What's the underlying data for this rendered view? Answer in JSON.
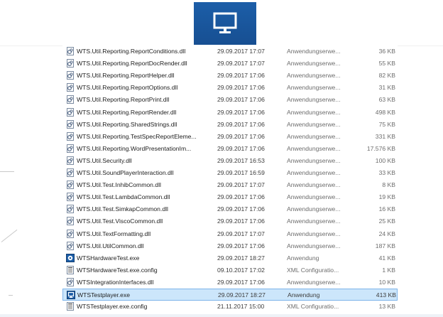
{
  "app_icon": {
    "icon": "monitor-icon",
    "color": "#1c5ea8"
  },
  "files": [
    {
      "name": "WTS.Util.Reporting.ReportConditions.dll",
      "date": "29.09.2017 17:07",
      "type": "Anwendungserwe...",
      "size": "36 KB",
      "icon": "dll-file-icon"
    },
    {
      "name": "WTS.Util.Reporting.ReportDocRender.dll",
      "date": "29.09.2017 17:07",
      "type": "Anwendungserwe...",
      "size": "55 KB",
      "icon": "dll-file-icon"
    },
    {
      "name": "WTS.Util.Reporting.ReportHelper.dll",
      "date": "29.09.2017 17:06",
      "type": "Anwendungserwe...",
      "size": "82 KB",
      "icon": "dll-file-icon"
    },
    {
      "name": "WTS.Util.Reporting.ReportOptions.dll",
      "date": "29.09.2017 17:06",
      "type": "Anwendungserwe...",
      "size": "31 KB",
      "icon": "dll-file-icon"
    },
    {
      "name": "WTS.Util.Reporting.ReportPrint.dll",
      "date": "29.09.2017 17:06",
      "type": "Anwendungserwe...",
      "size": "63 KB",
      "icon": "dll-file-icon"
    },
    {
      "name": "WTS.Util.Reporting.ReportRender.dll",
      "date": "29.09.2017 17:06",
      "type": "Anwendungserwe...",
      "size": "498 KB",
      "icon": "dll-file-icon"
    },
    {
      "name": "WTS.Util.Reporting.SharedStrings.dll",
      "date": "29.09.2017 17:06",
      "type": "Anwendungserwe...",
      "size": "75 KB",
      "icon": "dll-file-icon"
    },
    {
      "name": "WTS.Util.Reporting.TestSpecReportEleme...",
      "date": "29.09.2017 17:06",
      "type": "Anwendungserwe...",
      "size": "331 KB",
      "icon": "dll-file-icon"
    },
    {
      "name": "WTS.Util.Reporting.WordPresentationIm...",
      "date": "29.09.2017 17:06",
      "type": "Anwendungserwe...",
      "size": "17.576 KB",
      "icon": "dll-file-icon"
    },
    {
      "name": "WTS.Util.Security.dll",
      "date": "29.09.2017 16:53",
      "type": "Anwendungserwe...",
      "size": "100 KB",
      "icon": "dll-file-icon"
    },
    {
      "name": "WTS.Util.SoundPlayerInteraction.dll",
      "date": "29.09.2017 16:59",
      "type": "Anwendungserwe...",
      "size": "33 KB",
      "icon": "dll-file-icon"
    },
    {
      "name": "WTS.Util.Test.InhibCommon.dll",
      "date": "29.09.2017 17:07",
      "type": "Anwendungserwe...",
      "size": "8 KB",
      "icon": "dll-file-icon"
    },
    {
      "name": "WTS.Util.Test.LambdaCommon.dll",
      "date": "29.09.2017 17:06",
      "type": "Anwendungserwe...",
      "size": "19 KB",
      "icon": "dll-file-icon"
    },
    {
      "name": "WTS.Util.Test.SimkapCommon.dll",
      "date": "29.09.2017 17:06",
      "type": "Anwendungserwe...",
      "size": "16 KB",
      "icon": "dll-file-icon"
    },
    {
      "name": "WTS.Util.Test.ViscoCommon.dll",
      "date": "29.09.2017 17:06",
      "type": "Anwendungserwe...",
      "size": "25 KB",
      "icon": "dll-file-icon"
    },
    {
      "name": "WTS.Util.TextFormatting.dll",
      "date": "29.09.2017 17:07",
      "type": "Anwendungserwe...",
      "size": "24 KB",
      "icon": "dll-file-icon"
    },
    {
      "name": "WTS.Util.UtilCommon.dll",
      "date": "29.09.2017 17:06",
      "type": "Anwendungserwe...",
      "size": "187 KB",
      "icon": "dll-file-icon"
    },
    {
      "name": "WTSHardwareTest.exe",
      "date": "29.09.2017 18:27",
      "type": "Anwendung",
      "size": "41 KB",
      "icon": "exe-gear-icon"
    },
    {
      "name": "WTSHardwareTest.exe.config",
      "date": "09.10.2017 17:02",
      "type": "XML Configuratio...",
      "size": "1 KB",
      "icon": "config-file-icon"
    },
    {
      "name": "WTSIntegrationInterfaces.dll",
      "date": "29.09.2017 17:06",
      "type": "Anwendungserwe...",
      "size": "10 KB",
      "icon": "dll-file-icon"
    },
    {
      "name": "WTSTestplayer.exe",
      "date": "29.09.2017 18:27",
      "type": "Anwendung",
      "size": "413 KB",
      "icon": "exe-monitor-icon",
      "selected": true
    },
    {
      "name": "WTSTestplayer.exe.config",
      "date": "21.11.2017 15:00",
      "type": "XML Configuratio...",
      "size": "13 KB",
      "icon": "config-file-icon"
    }
  ],
  "colors": {
    "selection_bg": "#cce6fb",
    "selection_border": "#7eb4ea",
    "icon_blue": "#1c5ea8"
  }
}
